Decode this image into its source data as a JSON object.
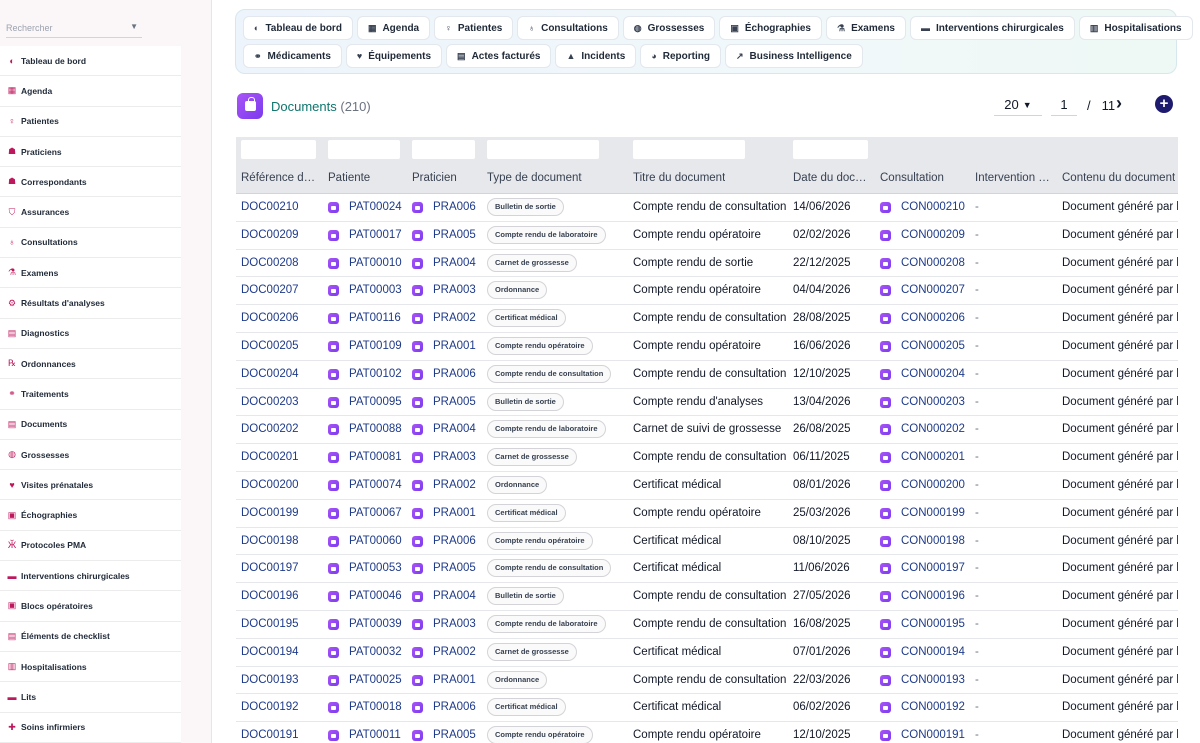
{
  "sidebar": {
    "search_placeholder": "Rechercher",
    "items": [
      {
        "label": "Tableau de bord",
        "icon": "dashboard-icon",
        "glyph": "◐"
      },
      {
        "label": "Agenda",
        "icon": "calendar-icon",
        "glyph": "▦"
      },
      {
        "label": "Patientes",
        "icon": "patient-icon",
        "glyph": "♀"
      },
      {
        "label": "Praticiens",
        "icon": "doctor-icon",
        "glyph": "☗"
      },
      {
        "label": "Correspondants",
        "icon": "contact-icon",
        "glyph": "☗"
      },
      {
        "label": "Assurances",
        "icon": "shield-icon",
        "glyph": "⛉"
      },
      {
        "label": "Consultations",
        "icon": "stethoscope-icon",
        "glyph": "♁"
      },
      {
        "label": "Examens",
        "icon": "microscope-icon",
        "glyph": "⚗"
      },
      {
        "label": "Résultats d'analyses",
        "icon": "lab-results-icon",
        "glyph": "⚙"
      },
      {
        "label": "Diagnostics",
        "icon": "clipboard-icon",
        "glyph": "▤"
      },
      {
        "label": "Ordonnances",
        "icon": "prescription-icon",
        "glyph": "℞"
      },
      {
        "label": "Traitements",
        "icon": "pills-icon",
        "glyph": "⚭"
      },
      {
        "label": "Documents",
        "icon": "document-icon",
        "glyph": "▤"
      },
      {
        "label": "Grossesses",
        "icon": "pregnancy-icon",
        "glyph": "◍"
      },
      {
        "label": "Visites prénatales",
        "icon": "prenatal-visit-icon",
        "glyph": "♥"
      },
      {
        "label": "Échographies",
        "icon": "ultrasound-icon",
        "glyph": "▣"
      },
      {
        "label": "Protocoles PMA",
        "icon": "dna-icon",
        "glyph": "Ӂ"
      },
      {
        "label": "Interventions chirurgicales",
        "icon": "bed-icon",
        "glyph": "▬"
      },
      {
        "label": "Blocs opératoires",
        "icon": "operating-room-icon",
        "glyph": "▣"
      },
      {
        "label": "Éléments de checklist",
        "icon": "checklist-icon",
        "glyph": "▤"
      },
      {
        "label": "Hospitalisations",
        "icon": "hospital-icon",
        "glyph": "▥"
      },
      {
        "label": "Lits",
        "icon": "bed-icon",
        "glyph": "▬"
      },
      {
        "label": "Soins infirmiers",
        "icon": "nurse-icon",
        "glyph": "✚"
      }
    ]
  },
  "topmenu": {
    "row1": [
      {
        "label": "Tableau de bord",
        "icon": "dashboard-icon",
        "glyph": "◐"
      },
      {
        "label": "Agenda",
        "icon": "calendar-icon",
        "glyph": "▦"
      },
      {
        "label": "Patientes",
        "icon": "patient-icon",
        "glyph": "♀"
      },
      {
        "label": "Consultations",
        "icon": "stethoscope-icon",
        "glyph": "♁"
      },
      {
        "label": "Grossesses",
        "icon": "pregnancy-icon",
        "glyph": "◍"
      },
      {
        "label": "Échographies",
        "icon": "ultrasound-icon",
        "glyph": "▣"
      },
      {
        "label": "Examens",
        "icon": "microscope-icon",
        "glyph": "⚗"
      },
      {
        "label": "Interventions chirurgicales",
        "icon": "bed-icon",
        "glyph": "▬"
      },
      {
        "label": "Hospitalisations",
        "icon": "hospital-icon",
        "glyph": "▥"
      }
    ],
    "row2": [
      {
        "label": "Médicaments",
        "icon": "pills-icon",
        "glyph": "⚭"
      },
      {
        "label": "Équipements",
        "icon": "heart-pulse-icon",
        "glyph": "♥"
      },
      {
        "label": "Actes facturés",
        "icon": "invoice-icon",
        "glyph": "▤"
      },
      {
        "label": "Incidents",
        "icon": "warning-icon",
        "glyph": "▲"
      },
      {
        "label": "Reporting",
        "icon": "pie-chart-icon",
        "glyph": "◕"
      },
      {
        "label": "Business Intelligence",
        "icon": "line-chart-icon",
        "glyph": "↗"
      }
    ]
  },
  "header": {
    "title": "Documents",
    "count": "(210)",
    "icon": "shopping-bag-icon",
    "page_size": "20",
    "page": "1",
    "separator": "/",
    "total_pages": "11",
    "next_glyph": "›",
    "add_glyph": "+"
  },
  "table": {
    "columns": [
      "Référence d…",
      "Patiente",
      "Praticien",
      "Type de document",
      "Titre du document",
      "Date du doc…",
      "Consultation",
      "Intervention …",
      "Contenu du document"
    ],
    "rows": [
      {
        "ref": "DOC00210",
        "patient": "PAT00024",
        "praticien": "PRA006",
        "type": "Bulletin de sortie",
        "titre": "Compte rendu de consultation",
        "date": "14/06/2026",
        "consultation": "CON000210",
        "intervention": "-",
        "contenu": "Document généré par le"
      },
      {
        "ref": "DOC00209",
        "patient": "PAT00017",
        "praticien": "PRA005",
        "type": "Compte rendu de laboratoire",
        "titre": "Compte rendu opératoire",
        "date": "02/02/2026",
        "consultation": "CON000209",
        "intervention": "-",
        "contenu": "Document généré par le"
      },
      {
        "ref": "DOC00208",
        "patient": "PAT00010",
        "praticien": "PRA004",
        "type": "Carnet de grossesse",
        "titre": "Compte rendu de sortie",
        "date": "22/12/2025",
        "consultation": "CON000208",
        "intervention": "-",
        "contenu": "Document généré par le"
      },
      {
        "ref": "DOC00207",
        "patient": "PAT00003",
        "praticien": "PRA003",
        "type": "Ordonnance",
        "titre": "Compte rendu opératoire",
        "date": "04/04/2026",
        "consultation": "CON000207",
        "intervention": "-",
        "contenu": "Document généré par le"
      },
      {
        "ref": "DOC00206",
        "patient": "PAT00116",
        "praticien": "PRA002",
        "type": "Certificat médical",
        "titre": "Compte rendu de consultation",
        "date": "28/08/2025",
        "consultation": "CON000206",
        "intervention": "-",
        "contenu": "Document généré par le"
      },
      {
        "ref": "DOC00205",
        "patient": "PAT00109",
        "praticien": "PRA001",
        "type": "Compte rendu opératoire",
        "titre": "Compte rendu opératoire",
        "date": "16/06/2026",
        "consultation": "CON000205",
        "intervention": "-",
        "contenu": "Document généré par le"
      },
      {
        "ref": "DOC00204",
        "patient": "PAT00102",
        "praticien": "PRA006",
        "type": "Compte rendu de consultation",
        "titre": "Compte rendu de consultation",
        "date": "12/10/2025",
        "consultation": "CON000204",
        "intervention": "-",
        "contenu": "Document généré par le"
      },
      {
        "ref": "DOC00203",
        "patient": "PAT00095",
        "praticien": "PRA005",
        "type": "Bulletin de sortie",
        "titre": "Compte rendu d'analyses",
        "date": "13/04/2026",
        "consultation": "CON000203",
        "intervention": "-",
        "contenu": "Document généré par le"
      },
      {
        "ref": "DOC00202",
        "patient": "PAT00088",
        "praticien": "PRA004",
        "type": "Compte rendu de laboratoire",
        "titre": "Carnet de suivi de grossesse",
        "date": "26/08/2025",
        "consultation": "CON000202",
        "intervention": "-",
        "contenu": "Document généré par le"
      },
      {
        "ref": "DOC00201",
        "patient": "PAT00081",
        "praticien": "PRA003",
        "type": "Carnet de grossesse",
        "titre": "Compte rendu de consultation",
        "date": "06/11/2025",
        "consultation": "CON000201",
        "intervention": "-",
        "contenu": "Document généré par le"
      },
      {
        "ref": "DOC00200",
        "patient": "PAT00074",
        "praticien": "PRA002",
        "type": "Ordonnance",
        "titre": "Certificat médical",
        "date": "08/01/2026",
        "consultation": "CON000200",
        "intervention": "-",
        "contenu": "Document généré par le"
      },
      {
        "ref": "DOC00199",
        "patient": "PAT00067",
        "praticien": "PRA001",
        "type": "Certificat médical",
        "titre": "Compte rendu opératoire",
        "date": "25/03/2026",
        "consultation": "CON000199",
        "intervention": "-",
        "contenu": "Document généré par le"
      },
      {
        "ref": "DOC00198",
        "patient": "PAT00060",
        "praticien": "PRA006",
        "type": "Compte rendu opératoire",
        "titre": "Certificat médical",
        "date": "08/10/2025",
        "consultation": "CON000198",
        "intervention": "-",
        "contenu": "Document généré par le"
      },
      {
        "ref": "DOC00197",
        "patient": "PAT00053",
        "praticien": "PRA005",
        "type": "Compte rendu de consultation",
        "titre": "Certificat médical",
        "date": "11/06/2026",
        "consultation": "CON000197",
        "intervention": "-",
        "contenu": "Document généré par le"
      },
      {
        "ref": "DOC00196",
        "patient": "PAT00046",
        "praticien": "PRA004",
        "type": "Bulletin de sortie",
        "titre": "Compte rendu de consultation",
        "date": "27/05/2026",
        "consultation": "CON000196",
        "intervention": "-",
        "contenu": "Document généré par le"
      },
      {
        "ref": "DOC00195",
        "patient": "PAT00039",
        "praticien": "PRA003",
        "type": "Compte rendu de laboratoire",
        "titre": "Compte rendu de consultation",
        "date": "16/08/2025",
        "consultation": "CON000195",
        "intervention": "-",
        "contenu": "Document généré par le"
      },
      {
        "ref": "DOC00194",
        "patient": "PAT00032",
        "praticien": "PRA002",
        "type": "Carnet de grossesse",
        "titre": "Certificat médical",
        "date": "07/01/2026",
        "consultation": "CON000194",
        "intervention": "-",
        "contenu": "Document généré par le"
      },
      {
        "ref": "DOC00193",
        "patient": "PAT00025",
        "praticien": "PRA001",
        "type": "Ordonnance",
        "titre": "Compte rendu de consultation",
        "date": "22/03/2026",
        "consultation": "CON000193",
        "intervention": "-",
        "contenu": "Document généré par le"
      },
      {
        "ref": "DOC00192",
        "patient": "PAT00018",
        "praticien": "PRA006",
        "type": "Certificat médical",
        "titre": "Certificat médical",
        "date": "06/02/2026",
        "consultation": "CON000192",
        "intervention": "-",
        "contenu": "Document généré par le"
      },
      {
        "ref": "DOC00191",
        "patient": "PAT00011",
        "praticien": "PRA005",
        "type": "Compte rendu opératoire",
        "titre": "Compte rendu opératoire",
        "date": "12/10/2025",
        "consultation": "CON000191",
        "intervention": "-",
        "contenu": "Document généré par le"
      }
    ]
  },
  "colors": {
    "accent_teal": "#0f766e",
    "link_navy": "#1e3a8a",
    "icon_purple": "#7c3aed",
    "sidebar_icon": "#be185d",
    "add_button": "#1e1b6e"
  }
}
